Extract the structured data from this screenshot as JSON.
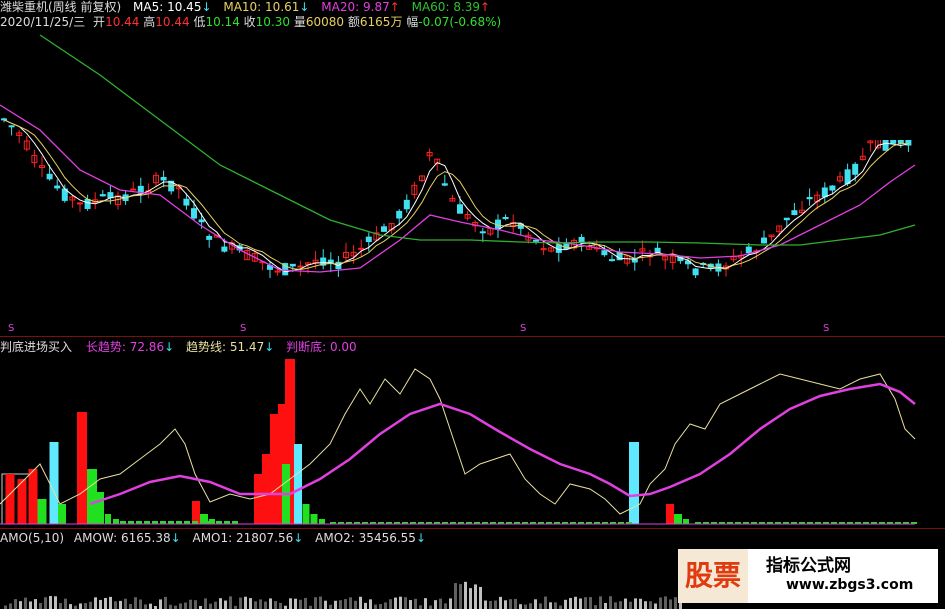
{
  "header": {
    "title": "潍柴重机(周线 前复权)",
    "ma5_label": "MA5:",
    "ma5": "10.45",
    "ma10_label": "MA10:",
    "ma10": "10.61",
    "ma20_label": "MA20:",
    "ma20": "9.87",
    "ma60_label": "MA60:",
    "ma60": "8.39",
    "date": "2020/11/25/三",
    "open_label": "开",
    "open": "10.44",
    "high_label": "高",
    "high": "10.44",
    "low_label": "低",
    "low": "10.14",
    "close_label": "收",
    "close": "10.30",
    "vol_label": "量",
    "vol": "60080",
    "amt_label": "额",
    "amt": "6165万",
    "chg_label": "幅",
    "chg": "-0.07(-0.68%)"
  },
  "indicator": {
    "name": "判底进场买入",
    "long_trend_label": "长趋势:",
    "long_trend": "72.86",
    "trend_label": "趋势线:",
    "trend": "51.47",
    "bottom_label": "判断底:",
    "bottom": "0.00"
  },
  "amo": {
    "name": "AMO(5,10)",
    "amow_label": "AMOW:",
    "amow": "6165.38",
    "amo1_label": "AMO1:",
    "amo1": "21807.56",
    "amo2_label": "AMO2:",
    "amo2": "35456.55"
  },
  "markers": [
    "S",
    "S",
    "S",
    "S"
  ],
  "watermark": {
    "left_text": "股票",
    "right_title": "指标公式网",
    "right_url": "www.zbgs3.com"
  },
  "colors": {
    "up": "#ff2020",
    "down": "#40e0f0",
    "ma5": "#ffffff",
    "ma10": "#e8d060",
    "ma20": "#e040e0",
    "ma60": "#30b030",
    "bar_red": "#ff1010",
    "bar_cyan": "#60e8ff",
    "bar_green": "#20e020"
  }
}
